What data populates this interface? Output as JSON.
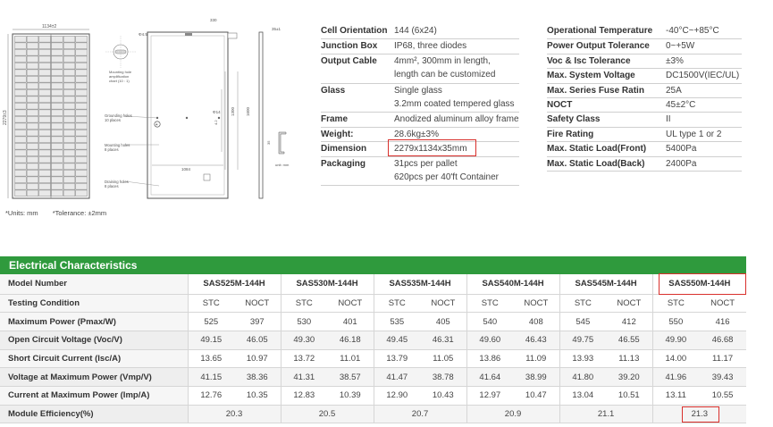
{
  "drawing": {
    "dims": {
      "width": "1134±2",
      "height": "2279±3",
      "top_small_a": "330",
      "top_small_b": "35±1",
      "hole_dia": "Φ4.5",
      "hole_spacing": "4.2",
      "inner_1": "1300",
      "inner_2": "1600",
      "bottom_width": "1084",
      "mounting_hole_dia": "Φ14",
      "frame_h": "35"
    },
    "callouts": {
      "mounting_amp": [
        "Mounting hole",
        "amplification",
        "chart (10 : 1)"
      ],
      "grounding": [
        "Grounding holes",
        "10 places"
      ],
      "mounting": [
        "Mounting holes",
        "8 places"
      ],
      "draining": [
        "Draining holes",
        "8 places"
      ],
      "unit": "unit: mm"
    },
    "footnotes": [
      "*Units: mm",
      "*Tolerance: ±2mm"
    ]
  },
  "spec_left": [
    {
      "key": "Cell Orientation",
      "value": "144 (6x24)"
    },
    {
      "key": "Junction Box",
      "value": "IP68, three diodes"
    },
    {
      "key": "Output Cable",
      "value": "4mm², 300mm in length,"
    },
    {
      "key": "",
      "value": "length can be customized"
    },
    {
      "key": "Glass",
      "value": "Single glass"
    },
    {
      "key": "",
      "value": "3.2mm coated tempered glass"
    },
    {
      "key": "Frame",
      "value": "Anodized aluminum alloy frame"
    },
    {
      "key": "Weight:",
      "value": "28.6kg±3%"
    },
    {
      "key": "Dimension",
      "value": "2279x1134x35mm"
    },
    {
      "key": "Packaging",
      "value": "31pcs per pallet"
    },
    {
      "key": "",
      "value": "620pcs per 40'ft Container"
    }
  ],
  "spec_right": [
    {
      "key": "Operational Temperature",
      "value": "-40°C~+85°C"
    },
    {
      "key": "Power Output Tolerance",
      "value": "0~+5W"
    },
    {
      "key": "Voc & Isc Tolerance",
      "value": "±3%"
    },
    {
      "key": "Max. System Voltage",
      "value": "DC1500V(IEC/UL)"
    },
    {
      "key": "Max. Series Fuse Ratin",
      "value": "25A"
    },
    {
      "key": "NOCT",
      "value": "45±2°C"
    },
    {
      "key": "Safety Class",
      "value": "II"
    },
    {
      "key": "Fire Rating",
      "value": "UL type 1 or 2"
    },
    {
      "key": "Max. Static Load(Front)",
      "value": "5400Pa"
    },
    {
      "key": "Max. Static Load(Back)",
      "value": "2400Pa"
    }
  ],
  "electrical": {
    "title": "Electrical Characteristics",
    "model_label": "Model Number",
    "models": [
      "SAS525M-144H",
      "SAS530M-144H",
      "SAS535M-144H",
      "SAS540M-144H",
      "SAS545M-144H",
      "SAS550M-144H"
    ],
    "condition_label": "Testing Condition",
    "conditions": [
      "STC",
      "NOCT",
      "STC",
      "NOCT",
      "STC",
      "NOCT",
      "STC",
      "NOCT",
      "STC",
      "NOCT",
      "STC",
      "NOCT"
    ],
    "rows": [
      {
        "label": "Maximum Power (Pmax/W)",
        "values": [
          "525",
          "397",
          "530",
          "401",
          "535",
          "405",
          "540",
          "408",
          "545",
          "412",
          "550",
          "416"
        ]
      },
      {
        "label": "Open Circuit Voltage (Voc/V)",
        "values": [
          "49.15",
          "46.05",
          "49.30",
          "46.18",
          "49.45",
          "46.31",
          "49.60",
          "46.43",
          "49.75",
          "46.55",
          "49.90",
          "46.68"
        ]
      },
      {
        "label": "Short Circuit Current (Isc/A)",
        "values": [
          "13.65",
          "10.97",
          "13.72",
          "11.01",
          "13.79",
          "11.05",
          "13.86",
          "11.09",
          "13.93",
          "11.13",
          "14.00",
          "11.17"
        ]
      },
      {
        "label": "Voltage at Maximum Power (Vmp/V)",
        "values": [
          "41.15",
          "38.36",
          "41.31",
          "38.57",
          "41.47",
          "38.78",
          "41.64",
          "38.99",
          "41.80",
          "39.20",
          "41.96",
          "39.43"
        ]
      },
      {
        "label": "Current at Maximum Power (Imp/A)",
        "values": [
          "12.76",
          "10.35",
          "12.83",
          "10.39",
          "12.90",
          "10.43",
          "12.97",
          "10.47",
          "13.04",
          "10.51",
          "13.11",
          "10.55"
        ]
      }
    ],
    "efficiency_label": "Module Efficiency(%)",
    "efficiency": [
      "20.3",
      "20.5",
      "20.7",
      "20.9",
      "21.1",
      "21.3"
    ]
  },
  "colors": {
    "header_green": "#2f9a3d",
    "highlight_red": "#d9302c"
  }
}
